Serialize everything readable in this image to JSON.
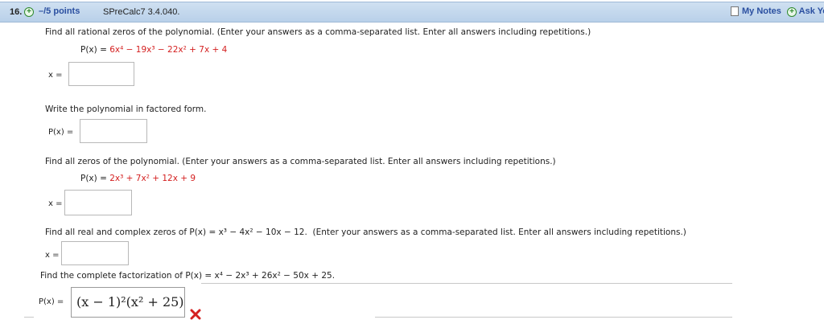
{
  "header": {
    "number": "16.",
    "points": "–/5 points",
    "code": "SPreCalc7 3.4.040.",
    "my_notes": "My Notes",
    "ask_your": "Ask Yo"
  },
  "q1": {
    "instruction": "Find all rational zeros of the polynomial. (Enter your answers as a comma-separated list. Enter all answers including repetitions.)",
    "poly_prefix": "P(x) = ",
    "poly_body": "6x⁴ − 19x³ − 22x² + 7x + 4",
    "answer_label": "x =",
    "factor_prompt": "Write the polynomial in factored form.",
    "factor_label": "P(x) ="
  },
  "q2": {
    "instruction": "Find all zeros of the polynomial. (Enter your answers as a comma-separated list. Enter all answers including repetitions.)",
    "poly_prefix": "P(x) = ",
    "poly_body": "2x³ + 7x² + 12x + 9",
    "answer_label": "x ="
  },
  "q3": {
    "instruction_a": "Find all real and complex zeros of ",
    "poly": "P(x) = x³ − 4x² − 10x − 12.",
    "instruction_b": "(Enter your answers as a comma-separated list. Enter all answers including repetitions.)",
    "answer_label": "x ="
  },
  "q4": {
    "instruction_a": "Find the complete factorization of ",
    "poly": "P(x) = x⁴ − 2x³ + 26x² − 50x + 25.",
    "answer_label": "P(x) =",
    "answer_value": "(x − 1)²(x² + 25)",
    "answer_status": "incorrect"
  },
  "colors": {
    "header_bg": "#c4d8ee",
    "link": "#2a4fa0",
    "incorrect": "#d42020",
    "coef": "#d42020"
  },
  "icons": [
    "plus-circle-icon",
    "notes-icon",
    "incorrect-x-icon"
  ]
}
